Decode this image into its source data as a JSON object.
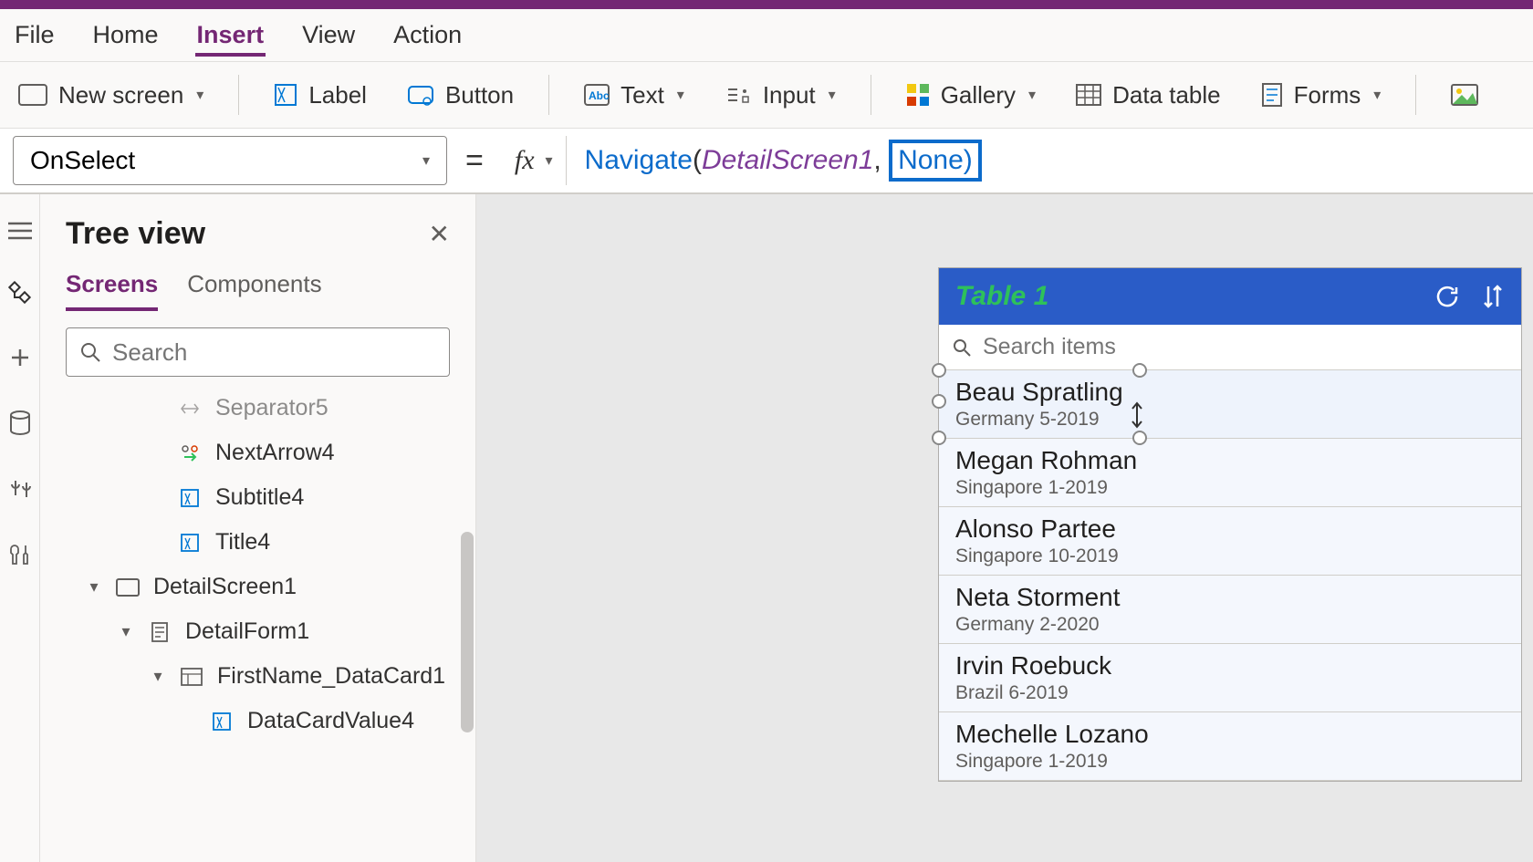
{
  "menu": {
    "items": [
      "File",
      "Home",
      "Insert",
      "View",
      "Action"
    ],
    "active": "Insert"
  },
  "ribbon": {
    "newScreen": "New screen",
    "label": "Label",
    "button": "Button",
    "text": "Text",
    "input": "Input",
    "gallery": "Gallery",
    "dataTable": "Data table",
    "forms": "Forms"
  },
  "formula": {
    "property": "OnSelect",
    "fn": "Navigate",
    "arg1": "DetailScreen1",
    "arg2": "None"
  },
  "tree": {
    "title": "Tree view",
    "tabs": {
      "screens": "Screens",
      "components": "Components"
    },
    "searchPlaceholder": "Search",
    "items": [
      {
        "indent": 150,
        "label": "Separator5",
        "icon": "separator"
      },
      {
        "indent": 150,
        "label": "NextArrow4",
        "icon": "nextarrow"
      },
      {
        "indent": 150,
        "label": "Subtitle4",
        "icon": "textlabel"
      },
      {
        "indent": 150,
        "label": "Title4",
        "icon": "textlabel"
      },
      {
        "indent": 50,
        "label": "DetailScreen1",
        "icon": "screen",
        "caret": "down"
      },
      {
        "indent": 85,
        "label": "DetailForm1",
        "icon": "form",
        "caret": "down"
      },
      {
        "indent": 120,
        "label": "FirstName_DataCard1",
        "icon": "datacard",
        "caret": "down"
      },
      {
        "indent": 185,
        "label": "DataCardValue4",
        "icon": "textlabel"
      }
    ]
  },
  "phone": {
    "title": "Table 1",
    "searchPlaceholder": "Search items",
    "rows": [
      {
        "name": "Beau Spratling",
        "sub": "Germany 5-2019",
        "selected": true
      },
      {
        "name": "Megan Rohman",
        "sub": "Singapore 1-2019"
      },
      {
        "name": "Alonso Partee",
        "sub": "Singapore 10-2019"
      },
      {
        "name": "Neta Storment",
        "sub": "Germany 2-2020"
      },
      {
        "name": "Irvin Roebuck",
        "sub": "Brazil 6-2019"
      },
      {
        "name": "Mechelle Lozano",
        "sub": "Singapore 1-2019"
      }
    ]
  }
}
